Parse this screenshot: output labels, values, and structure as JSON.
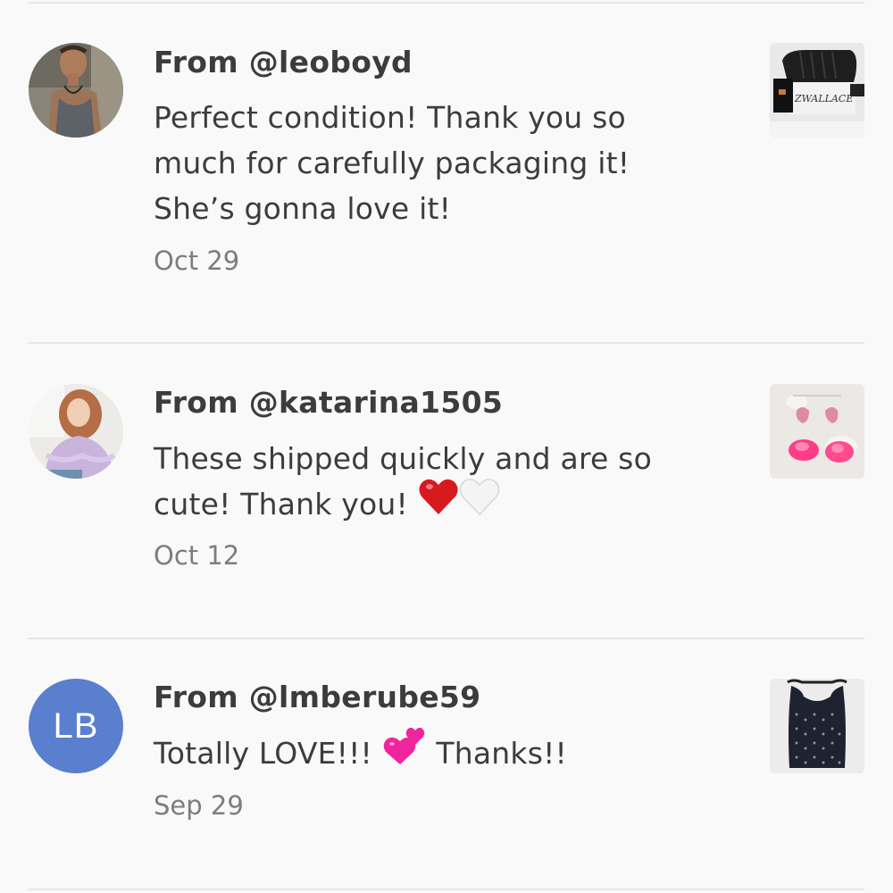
{
  "reviews": [
    {
      "from": "From @leoboyd",
      "text": "Perfect condition! Thank you so much for carefully packaging it! She’s gonna love it!",
      "date": "Oct 29",
      "avatar": "photo",
      "thumb_text": "ZWALLACE"
    },
    {
      "from": "From @katarina1505",
      "text": "These shipped quickly and are so cute! Thank you!",
      "emojis": [
        "red-heart-emoji",
        "white-heart-emoji"
      ],
      "date": "Oct 12",
      "avatar": "photo"
    },
    {
      "from": "From @lmberube59",
      "text_before": "Totally LOVE!!!",
      "text_after": "Thanks!!",
      "emojis": [
        "two-hearts-emoji"
      ],
      "date": "Sep 29",
      "avatar_initials": "LB"
    }
  ],
  "colors": {
    "avatar_initials_bg": "#5a7fcf",
    "text": "#3c3c3c",
    "date": "#7d7d7d",
    "divider": "#e6e6e8",
    "background": "#f9f9fa"
  }
}
